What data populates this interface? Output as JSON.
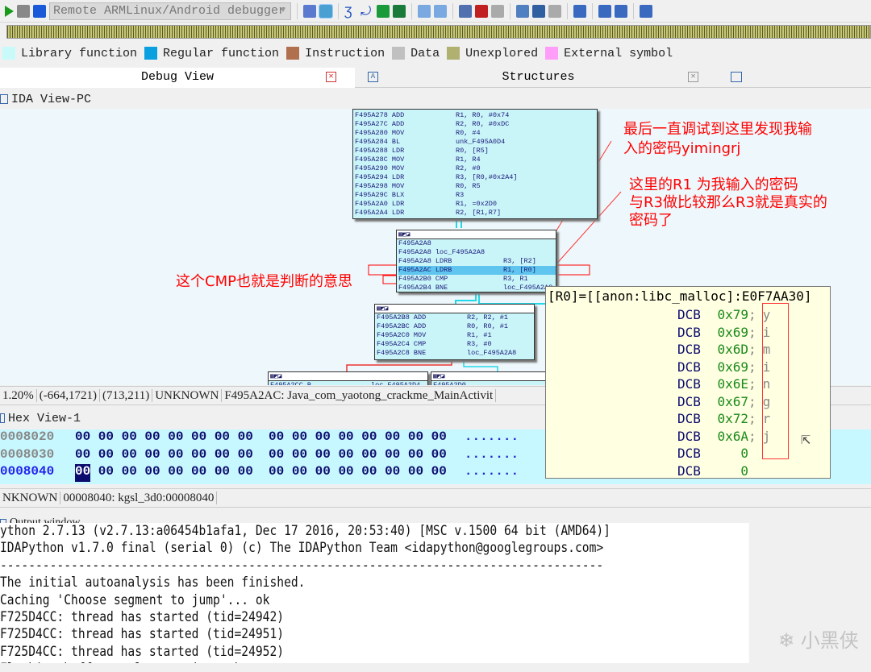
{
  "toolbar": {
    "debugger_select": "Remote ARMLinux/Android debugger",
    "icons": [
      "play-icon",
      "pause-icon",
      "stop-icon",
      "attach-icon",
      "detach-icon",
      "step-into-icon",
      "step-over-icon",
      "run-to-cursor-icon",
      "return-icon",
      "view-icon",
      "view2-icon",
      "breakpoint-icon",
      "add-breakpoint-icon",
      "delete-breakpoint-icon",
      "watch-icon",
      "add-watch-icon",
      "delete-watch-icon",
      "stack-icon",
      "trace-icon",
      "trace-func-icon",
      "memory-icon"
    ]
  },
  "legend": [
    {
      "label": "Library function",
      "color": "#c8fafa"
    },
    {
      "label": "Regular function",
      "color": "#0aa0e0"
    },
    {
      "label": "Instruction",
      "color": "#b07050"
    },
    {
      "label": "Data",
      "color": "#c0c0c0"
    },
    {
      "label": "Unexplored",
      "color": "#b0b070"
    },
    {
      "label": "External symbol",
      "color": "#ff9ef8"
    }
  ],
  "tabs": [
    {
      "label": "Debug View"
    },
    {
      "label": "Structures"
    }
  ],
  "ida_view": {
    "title": "IDA View-PC"
  },
  "nodes": {
    "n1": [
      [
        "F495A278 ADD",
        "R1, R0, #0x74"
      ],
      [
        "F495A27C ADD",
        "R2, R0, #0xDC"
      ],
      [
        "F495A280 MOV",
        "R0, #4"
      ],
      [
        "F495A284 BL",
        "unk_F495A0D4"
      ],
      [
        "F495A288 LDR",
        "R0, [R5]"
      ],
      [
        "F495A28C MOV",
        "R1, R4"
      ],
      [
        "F495A290 MOV",
        "R2, #0"
      ],
      [
        "F495A294 LDR",
        "R3, [R0,#0x2A4]"
      ],
      [
        "F495A298 MOV",
        "R0, R5"
      ],
      [
        "F495A29C BLX",
        "R3"
      ],
      [
        "F495A2A0 LDR",
        "R1, =0x2D0"
      ],
      [
        "F495A2A4 LDR",
        "R2, [R1,R7]"
      ]
    ],
    "n2": [
      [
        "F495A2A8",
        ""
      ],
      [
        "F495A2A8 loc_F495A2A8",
        ""
      ],
      [
        "F495A2A8 LDRB",
        "R3, [R2]"
      ],
      [
        "F495A2AC LDRB",
        "R1, [R0]"
      ],
      [
        "F495A2B0 CMP",
        "R3, R1"
      ],
      [
        "F495A2B4 BNE",
        "loc_F495A2A8"
      ]
    ],
    "n3": [
      [
        "F495A2B8 ADD",
        "R2, R2, #1"
      ],
      [
        "F495A2BC ADD",
        "R0, R0, #1"
      ],
      [
        "F495A2C0 MOV",
        "R1, #1"
      ],
      [
        "F495A2C4 CMP",
        "R3, #0"
      ],
      [
        "F495A2C8 BNE",
        "loc_F495A2A8"
      ]
    ],
    "n4": [
      [
        "F495A2CC B",
        "loc_F495A2D4"
      ]
    ],
    "n5": [
      [
        "F495A2D0",
        ""
      ]
    ]
  },
  "annotations": {
    "a1": "最后一直调试到这里发现我输\n入的密码yimingrj",
    "a2": "这里的R1 为我输入的密码\n与R3做比较那么R3就是真实的\n密码了",
    "a3": "这个CMP也就是判断的意思"
  },
  "graph_status": {
    "zoom": "1.20%",
    "coords1": "(-664,1721)",
    "coords2": "(713,211)",
    "seg": "UNKNOWN",
    "loc": "F495A2AC: Java_com_yaotong_crackme_MainActivit"
  },
  "hex_view": {
    "title": "Hex View-1",
    "rows": [
      {
        "addr": "0008020",
        "bytes": "00 00 00 00 00 00 00 00  00 00 00 00 00 00 00 00",
        "ascii": "......."
      },
      {
        "addr": "0008030",
        "bytes": "00 00 00 00 00 00 00 00  00 00 00 00 00 00 00 00",
        "ascii": "......."
      },
      {
        "addr": "0008040",
        "first": "00",
        "bytes": " 00 00 00 00 00 00 00  00 00 00 00 00 00 00 00",
        "ascii": "......."
      }
    ],
    "status_seg": "NKNOWN",
    "status_loc": "00008040: kgsl_3d0:00008040"
  },
  "tooltip": {
    "header": "[R0]=[[anon:libc_malloc]:E0F7AA30]",
    "rows": [
      {
        "op": "DCB",
        "val": "0x79",
        "ch": "y"
      },
      {
        "op": "DCB",
        "val": "0x69",
        "ch": "i"
      },
      {
        "op": "DCB",
        "val": "0x6D",
        "ch": "m"
      },
      {
        "op": "DCB",
        "val": "0x69",
        "ch": "i"
      },
      {
        "op": "DCB",
        "val": "0x6E",
        "ch": "n"
      },
      {
        "op": "DCB",
        "val": "0x67",
        "ch": "g"
      },
      {
        "op": "DCB",
        "val": "0x72",
        "ch": "r"
      },
      {
        "op": "DCB",
        "val": "0x6A",
        "ch": "j"
      },
      {
        "op": "DCB",
        "val": "0",
        "ch": ""
      },
      {
        "op": "DCB",
        "val": "0",
        "ch": ""
      }
    ]
  },
  "output": {
    "title": "Output window",
    "lines": [
      "ython 2.7.13 (v2.7.13:a06454b1afa1, Dec 17 2016, 20:53:40) [MSC v.1500 64 bit (AMD64)]",
      "IDAPython v1.7.0 final (serial 0) (c) The IDAPython Team <idapython@googlegroups.com>",
      "-------------------------------------------------------------------------------------",
      "The initial autoanalysis has been finished.",
      "Caching 'Choose segment to jump'... ok",
      "F725D4CC: thread has started (tid=24942)",
      "F725D4CC: thread has started (tid=24951)",
      "F725D4CC: thread has started (tid=24952)",
      "Flushing buffers, please wait...ok"
    ]
  },
  "watermark": "小黑侠"
}
